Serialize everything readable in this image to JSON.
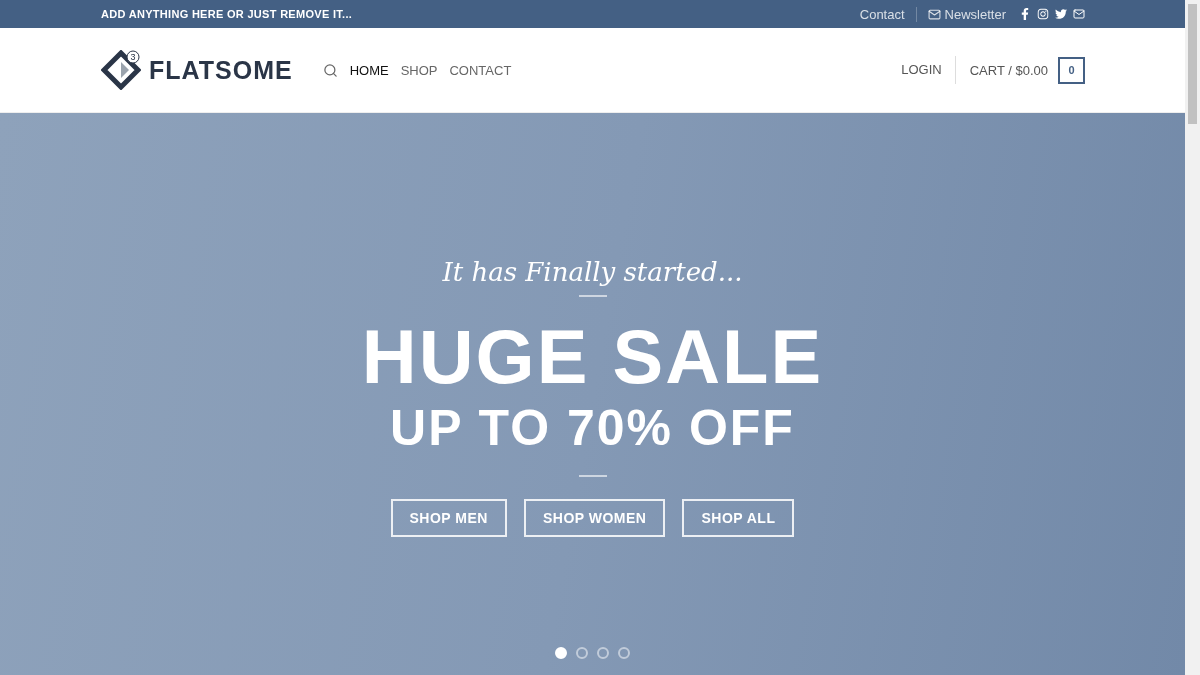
{
  "top_bar": {
    "message": "ADD ANYTHING HERE OR JUST REMOVE IT...",
    "links": [
      {
        "label": "Contact",
        "kind": "text"
      },
      {
        "label": "Newsletter",
        "kind": "mail"
      }
    ],
    "social": [
      {
        "kind": "facebook"
      },
      {
        "kind": "instagram"
      },
      {
        "kind": "twitter"
      },
      {
        "kind": "email"
      }
    ]
  },
  "header": {
    "logo": {
      "badge": "3",
      "name": "FLATSOME"
    },
    "nav": [
      {
        "label": "HOME",
        "selected": true
      },
      {
        "label": "SHOP",
        "selected": false
      },
      {
        "label": "CONTACT",
        "selected": false
      }
    ],
    "login": "LOGIN",
    "cart": {
      "label": "CART / $0.00",
      "count": "0"
    }
  },
  "hero": {
    "kicker": "It has Finally started...",
    "title": "HUGE SALE",
    "subtitle": "UP TO 70% OFF",
    "buttons": [
      "SHOP MEN",
      "SHOP WOMEN",
      "SHOP ALL"
    ],
    "dots": [
      {
        "selected": true
      },
      {
        "selected": false
      },
      {
        "selected": false
      },
      {
        "selected": false
      }
    ]
  }
}
